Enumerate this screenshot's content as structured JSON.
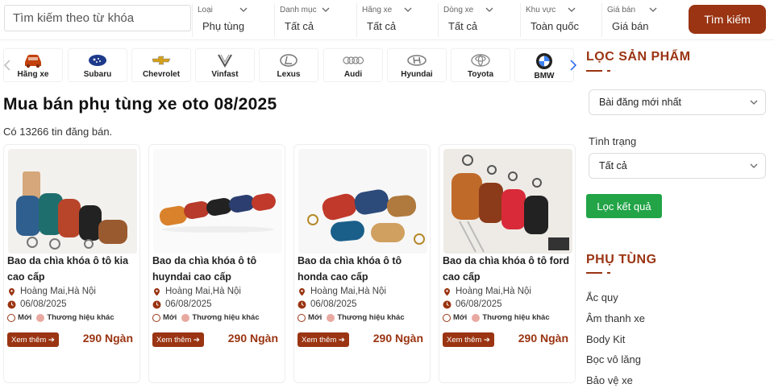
{
  "search": {
    "placeholder": "Tìm kiếm theo từ khóa"
  },
  "filters": [
    {
      "label": "Loại",
      "value": "Phụ tùng"
    },
    {
      "label": "Danh mục",
      "value": "Tất cả"
    },
    {
      "label": "Hãng xe",
      "value": "Tất cả"
    },
    {
      "label": "Dòng xe",
      "value": "Tất cả"
    },
    {
      "label": "Khu vực",
      "value": "Toàn quốc"
    },
    {
      "label": "Giá bán",
      "value": "Giá bán"
    }
  ],
  "search_button": "Tìm kiếm",
  "brands": [
    {
      "name": "Hãng xe",
      "icon": "car-icon"
    },
    {
      "name": "Subaru",
      "icon": "subaru-logo"
    },
    {
      "name": "Chevrolet",
      "icon": "chevrolet-logo"
    },
    {
      "name": "Vinfast",
      "icon": "vinfast-logo"
    },
    {
      "name": "Lexus",
      "icon": "lexus-logo"
    },
    {
      "name": "Audi",
      "icon": "audi-logo"
    },
    {
      "name": "Hyundai",
      "icon": "hyundai-logo"
    },
    {
      "name": "Toyota",
      "icon": "toyota-logo"
    },
    {
      "name": "BMW",
      "icon": "bmw-logo"
    }
  ],
  "page_title": "Mua bán phụ tùng xe oto 08/2025",
  "listing_count": "Có 13266 tin đăng bán.",
  "cards": [
    {
      "title": "Bao da chìa khóa ô tô kia cao cấp",
      "location": "Hoàng Mai,Hà Nội",
      "date": "06/08/2025",
      "tag_new": "Mới",
      "tag_brand": "Thương hiệu khác",
      "more": "Xem thêm",
      "price": "290 Ngàn"
    },
    {
      "title": "Bao da chìa khóa ô tô huyndai cao cấp",
      "location": "Hoàng Mai,Hà Nội",
      "date": "06/08/2025",
      "tag_new": "Mới",
      "tag_brand": "Thương hiệu khác",
      "more": "Xem thêm",
      "price": "290 Ngàn"
    },
    {
      "title": "Bao da chìa khóa ô tô honda cao cấp",
      "location": "Hoàng Mai,Hà Nội",
      "date": "06/08/2025",
      "tag_new": "Mới",
      "tag_brand": "Thương hiệu khác",
      "more": "Xem thêm",
      "price": "290 Ngàn"
    },
    {
      "title": "Bao da chìa khóa ô tô ford cao cấp",
      "location": "Hoàng Mai,Hà Nội",
      "date": "06/08/2025",
      "tag_new": "Mới",
      "tag_brand": "Thương hiệu khác",
      "more": "Xem thêm",
      "price": "290 Ngàn"
    }
  ],
  "sidebar": {
    "filter_heading": "LỌC SẢN PHẨM",
    "sort_value": "Bài đăng mới nhất",
    "status_label": "Tình trạng",
    "status_value": "Tất cả",
    "filter_button": "Lọc kết quả",
    "category_heading": "PHỤ TÙNG",
    "categories": [
      "Ắc quy",
      "Âm thanh xe",
      "Body Kit",
      "Bọc vô lăng",
      "Bảo vệ xe"
    ]
  },
  "colors": {
    "accent": "#9a3412",
    "green": "#22a447"
  }
}
